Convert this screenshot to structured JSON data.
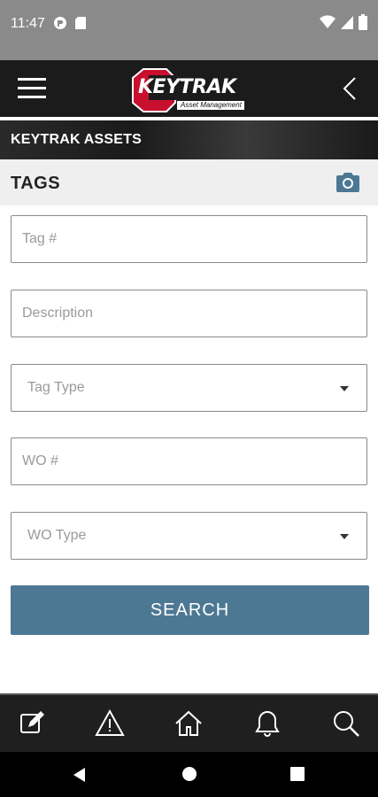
{
  "status": {
    "time": "11:47"
  },
  "header": {
    "logo_text": "KeyTrak",
    "logo_sub": "Asset Management"
  },
  "title": "KEYTRAK ASSETS",
  "section": {
    "label": "TAGS"
  },
  "form": {
    "tag_placeholder": "Tag #",
    "description_placeholder": "Description",
    "tag_type_placeholder": "Tag Type",
    "wo_placeholder": "WO #",
    "wo_type_placeholder": "WO Type"
  },
  "search_label": "SEARCH",
  "icons": {
    "menu": "hamburger-menu-icon",
    "back": "chevron-left-icon",
    "camera": "camera-icon",
    "nav": [
      "edit-icon",
      "warning-icon",
      "home-icon",
      "bell-icon",
      "search-icon"
    ]
  },
  "colors": {
    "accent": "#4d7894",
    "appbar": "#1b1b1b",
    "logo_red": "#c8102e"
  }
}
